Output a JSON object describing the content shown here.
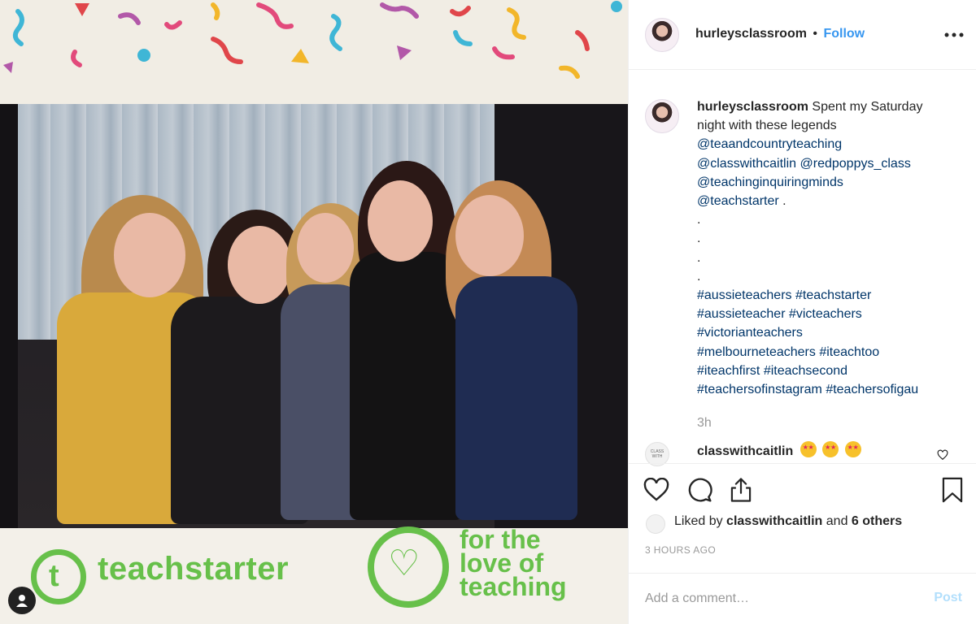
{
  "photo": {
    "alt_semantic": "group-photo",
    "banner": {
      "brand_left": "teachstarter",
      "brand_right_lines": [
        "for the",
        "love of",
        "teaching"
      ]
    },
    "brand_green": "#67c04a"
  },
  "header": {
    "username": "hurleysclassroom",
    "separator": "•",
    "follow_label": "Follow",
    "more_icon": "ellipsis-icon"
  },
  "caption": {
    "username": "hurleysclassroom",
    "text_start": "Spent my Saturday",
    "text_cont": "night with these legends",
    "mentions": [
      "@teaandcountryteaching",
      "@classwithcaitlin",
      "@redpoppys_class",
      "@teachinginquiringminds",
      "@teachstarter"
    ],
    "mention_tail": " .",
    "dots": [
      ".",
      ".",
      ".",
      "."
    ],
    "hashtag_lines": [
      [
        "#aussieteachers",
        "#teachstarter"
      ],
      [
        "#aussieteacher",
        "#victeachers"
      ],
      [
        "#victorianteachers"
      ],
      [
        "#melbourneteachers",
        "#iteachtoo"
      ],
      [
        "#iteachfirst",
        "#iteachsecond"
      ],
      [
        "#teachersofinstagram",
        "#teachersofigau"
      ]
    ],
    "time_ago": "3h"
  },
  "comments": [
    {
      "username": "classwithcaitlin",
      "emoji_count": 3,
      "avatar_text": "CLASS WITH"
    }
  ],
  "actions": {
    "like_icon": "heart-icon",
    "comment_icon": "comment-icon",
    "share_icon": "share-icon",
    "save_icon": "bookmark-icon"
  },
  "likes": {
    "prefix": "Liked by",
    "user": "classwithcaitlin",
    "middle": "and",
    "others": "6 others"
  },
  "timestamp": "3 HOURS AGO",
  "comment_box": {
    "placeholder": "Add a comment…",
    "post_label": "Post"
  },
  "colors": {
    "link": "#003569",
    "follow": "#3897f0",
    "post_disabled": "#b2dffc",
    "muted": "#999999"
  }
}
